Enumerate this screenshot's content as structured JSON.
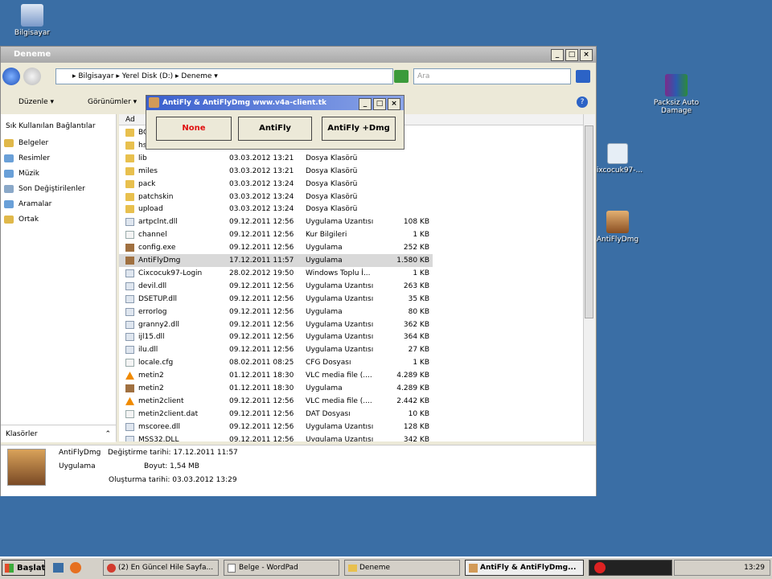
{
  "desktop": {
    "icons": [
      {
        "label": "Bilgisayar"
      },
      {
        "label": "Packsiz Auto Damage"
      },
      {
        "label": "cixcocuk97-..."
      },
      {
        "label": "AntiFlyDmg"
      }
    ]
  },
  "explorer": {
    "title": "Deneme",
    "address": {
      "parts": [
        "Bilgisayar",
        "Yerel Disk (D:)",
        "Deneme"
      ],
      "text": "▸ Bilgisayar ▸ Yerel Disk (D:) ▸ Deneme ▾"
    },
    "search_placeholder": "Ara",
    "toolbar": {
      "organize": "Düzenle",
      "views": "Görünümler"
    },
    "column_name": "Ad",
    "left_pane": {
      "header": "Sık Kullanılan Bağlantılar",
      "links": [
        "Belgeler",
        "Resimler",
        "Müzik",
        "Son Değiştirilenler",
        "Aramalar",
        "Ortak"
      ],
      "folders_label": "Klasörler"
    },
    "files": [
      {
        "name": "BC",
        "date": "",
        "type": "",
        "size": "",
        "icon": "folder"
      },
      {
        "name": "hs",
        "date": "",
        "type": "",
        "size": "",
        "icon": "folder"
      },
      {
        "name": "lib",
        "date": "03.03.2012 13:21",
        "type": "Dosya Klasörü",
        "size": "",
        "icon": "folder"
      },
      {
        "name": "miles",
        "date": "03.03.2012 13:21",
        "type": "Dosya Klasörü",
        "size": "",
        "icon": "folder"
      },
      {
        "name": "pack",
        "date": "03.03.2012 13:24",
        "type": "Dosya Klasörü",
        "size": "",
        "icon": "folder"
      },
      {
        "name": "patchskin",
        "date": "03.03.2012 13:24",
        "type": "Dosya Klasörü",
        "size": "",
        "icon": "folder"
      },
      {
        "name": "upload",
        "date": "03.03.2012 13:24",
        "type": "Dosya Klasörü",
        "size": "",
        "icon": "folder"
      },
      {
        "name": "artpclnt.dll",
        "date": "09.12.2011 12:56",
        "type": "Uygulama Uzantısı",
        "size": "108 KB",
        "icon": "dll"
      },
      {
        "name": "channel",
        "date": "09.12.2011 12:56",
        "type": "Kur Bilgileri",
        "size": "1 KB",
        "icon": "file"
      },
      {
        "name": "config.exe",
        "date": "09.12.2011 12:56",
        "type": "Uygulama",
        "size": "252 KB",
        "icon": "app"
      },
      {
        "name": "AntiFlyDmg",
        "date": "17.12.2011 11:57",
        "type": "Uygulama",
        "size": "1.580 KB",
        "icon": "app",
        "selected": true
      },
      {
        "name": "Cixcocuk97-Login",
        "date": "28.02.2012 19:50",
        "type": "Windows Toplu İ...",
        "size": "1 KB",
        "icon": "dll"
      },
      {
        "name": "devil.dll",
        "date": "09.12.2011 12:56",
        "type": "Uygulama Uzantısı",
        "size": "263 KB",
        "icon": "dll"
      },
      {
        "name": "DSETUP.dll",
        "date": "09.12.2011 12:56",
        "type": "Uygulama Uzantısı",
        "size": "35 KB",
        "icon": "dll"
      },
      {
        "name": "errorlog",
        "date": "09.12.2011 12:56",
        "type": "Uygulama",
        "size": "80 KB",
        "icon": "dll"
      },
      {
        "name": "granny2.dll",
        "date": "09.12.2011 12:56",
        "type": "Uygulama Uzantısı",
        "size": "362 KB",
        "icon": "dll"
      },
      {
        "name": "ijl15.dll",
        "date": "09.12.2011 12:56",
        "type": "Uygulama Uzantısı",
        "size": "364 KB",
        "icon": "dll"
      },
      {
        "name": "ilu.dll",
        "date": "09.12.2011 12:56",
        "type": "Uygulama Uzantısı",
        "size": "27 KB",
        "icon": "dll"
      },
      {
        "name": "locale.cfg",
        "date": "08.02.2011 08:25",
        "type": "CFG Dosyası",
        "size": "1 KB",
        "icon": "file"
      },
      {
        "name": "metin2",
        "date": "01.12.2011 18:30",
        "type": "VLC media file (....",
        "size": "4.289 KB",
        "icon": "vlc"
      },
      {
        "name": "metin2",
        "date": "01.12.2011 18:30",
        "type": "Uygulama",
        "size": "4.289 KB",
        "icon": "app"
      },
      {
        "name": "metin2client",
        "date": "09.12.2011 12:56",
        "type": "VLC media file (....",
        "size": "2.442 KB",
        "icon": "vlc"
      },
      {
        "name": "metin2client.dat",
        "date": "09.12.2011 12:56",
        "type": "DAT Dosyası",
        "size": "10 KB",
        "icon": "file"
      },
      {
        "name": "mscoree.dll",
        "date": "09.12.2011 12:56",
        "type": "Uygulama Uzantısı",
        "size": "128 KB",
        "icon": "dll"
      },
      {
        "name": "MSS32.DLL",
        "date": "09.12.2011 12:56",
        "type": "Uygulama Uzantısı",
        "size": "342 KB",
        "icon": "dll"
      }
    ],
    "details": {
      "name": "AntiFlyDmg",
      "type": "Uygulama",
      "modified": "Değiştirme tarihi: 17.12.2011 11:57",
      "size": "Boyut: 1,54 MB",
      "created": "Oluşturma tarihi: 03.03.2012 13:29"
    }
  },
  "dialog": {
    "title": "AntiFly & AntiFlyDmg www.v4a-client.tk",
    "buttons": [
      "None",
      "AntiFly",
      "AntiFly +Dmg"
    ],
    "none_color": "#e01010"
  },
  "taskbar": {
    "start": "Başlat",
    "tasks": [
      "(2) En Güncel Hile Sayfa...",
      "Belge - WordPad",
      "Deneme",
      "AntiFly & AntiFlyDmg..."
    ],
    "clock": "13:29"
  },
  "colors": {
    "desktop": "#3a6ea5",
    "selection": "#d9d9d9"
  }
}
